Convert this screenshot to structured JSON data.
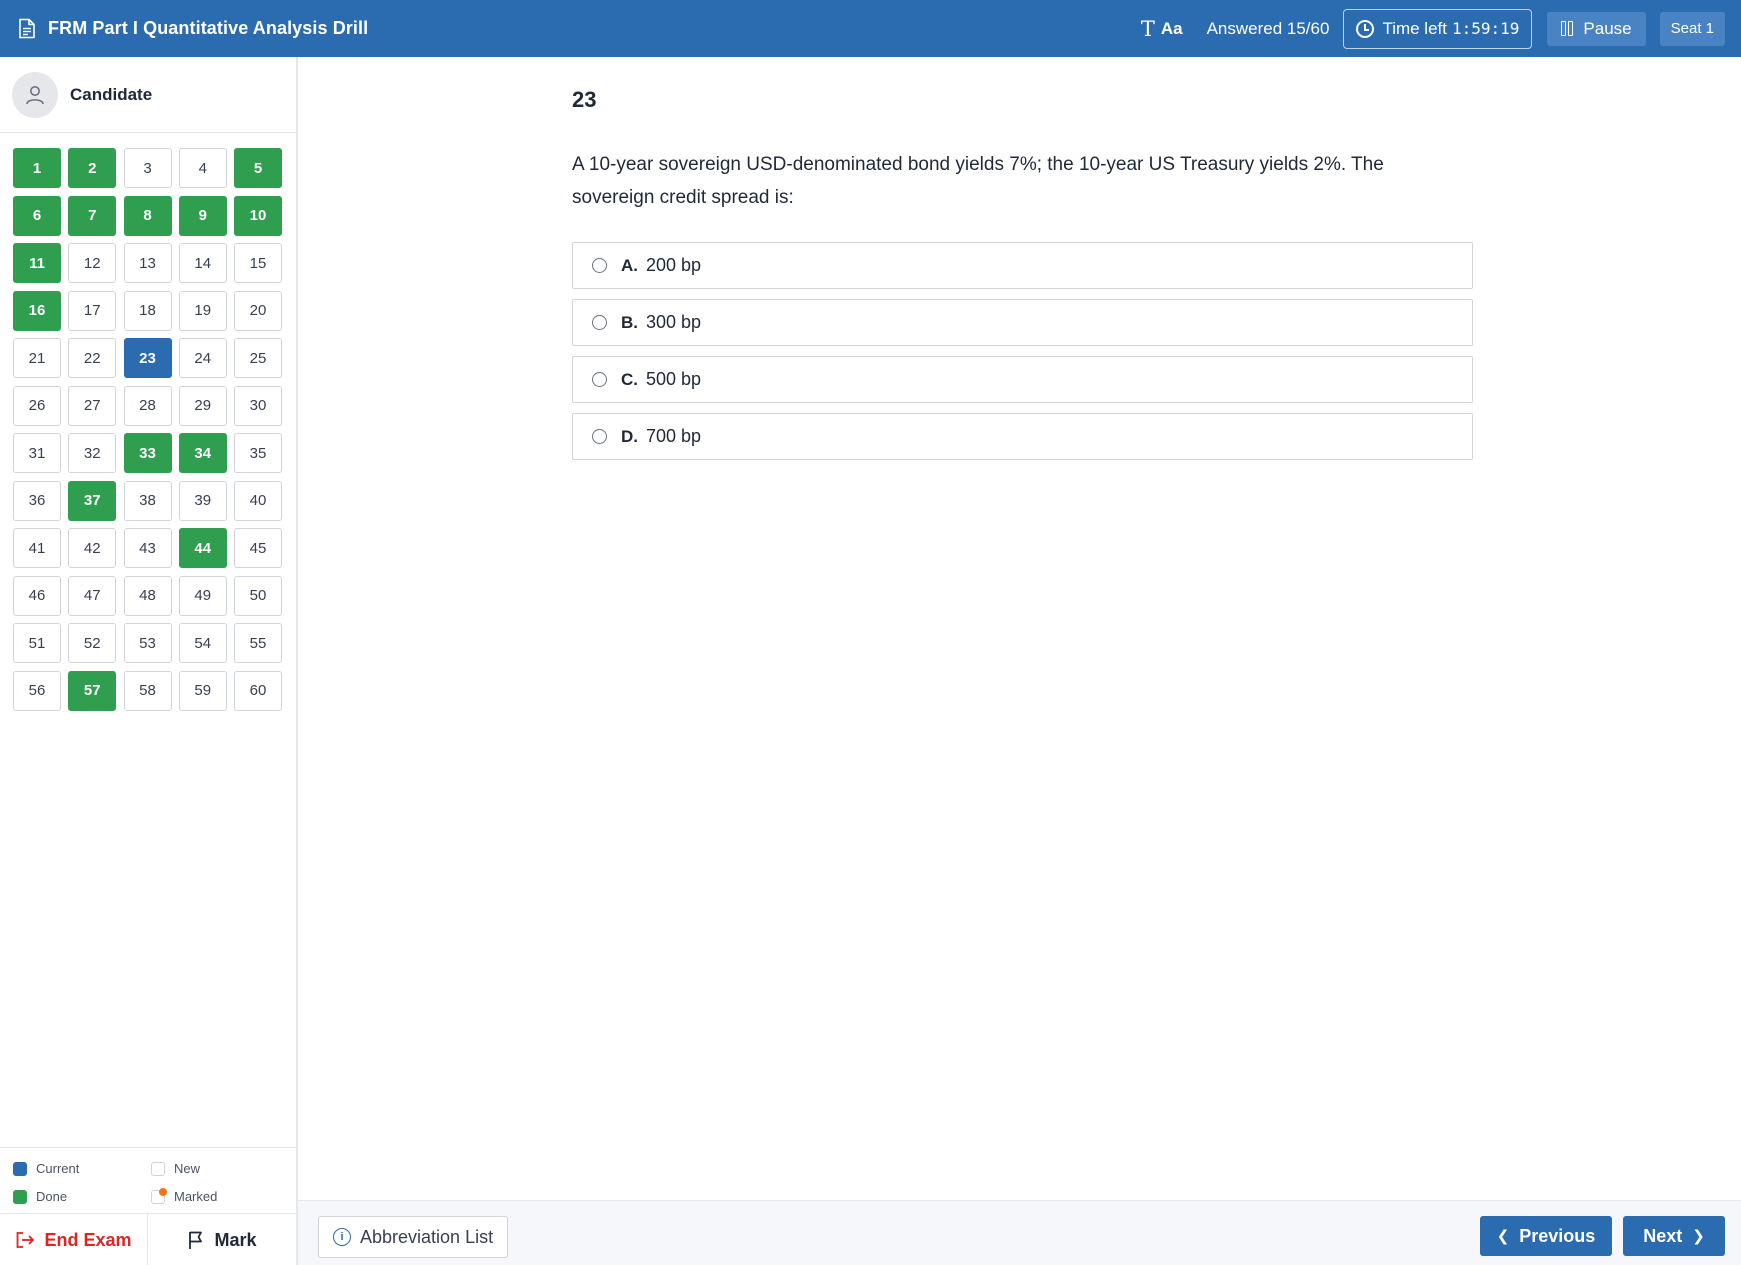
{
  "header": {
    "app_title": "FRM Part I Quantitative Analysis Drill",
    "font_size_label": "Aa",
    "answered": "Answered 15/60",
    "time_left_label": "Time left",
    "time_left_value": "1:59:19",
    "pause_label": "Pause",
    "seat_label": "Seat 1"
  },
  "sidebar": {
    "candidate_name": "Candidate",
    "questions": [
      {
        "n": "1",
        "state": "done"
      },
      {
        "n": "2",
        "state": "done"
      },
      {
        "n": "3",
        "state": "new"
      },
      {
        "n": "4",
        "state": "new"
      },
      {
        "n": "5",
        "state": "done"
      },
      {
        "n": "6",
        "state": "done"
      },
      {
        "n": "7",
        "state": "done"
      },
      {
        "n": "8",
        "state": "done"
      },
      {
        "n": "9",
        "state": "done"
      },
      {
        "n": "10",
        "state": "done"
      },
      {
        "n": "11",
        "state": "done"
      },
      {
        "n": "12",
        "state": "new"
      },
      {
        "n": "13",
        "state": "new"
      },
      {
        "n": "14",
        "state": "new"
      },
      {
        "n": "15",
        "state": "new"
      },
      {
        "n": "16",
        "state": "done"
      },
      {
        "n": "17",
        "state": "new"
      },
      {
        "n": "18",
        "state": "new"
      },
      {
        "n": "19",
        "state": "new"
      },
      {
        "n": "20",
        "state": "new"
      },
      {
        "n": "21",
        "state": "new"
      },
      {
        "n": "22",
        "state": "new"
      },
      {
        "n": "23",
        "state": "current"
      },
      {
        "n": "24",
        "state": "new"
      },
      {
        "n": "25",
        "state": "new"
      },
      {
        "n": "26",
        "state": "new"
      },
      {
        "n": "27",
        "state": "new"
      },
      {
        "n": "28",
        "state": "new"
      },
      {
        "n": "29",
        "state": "new"
      },
      {
        "n": "30",
        "state": "new"
      },
      {
        "n": "31",
        "state": "new"
      },
      {
        "n": "32",
        "state": "new"
      },
      {
        "n": "33",
        "state": "done"
      },
      {
        "n": "34",
        "state": "done"
      },
      {
        "n": "35",
        "state": "new"
      },
      {
        "n": "36",
        "state": "new"
      },
      {
        "n": "37",
        "state": "done"
      },
      {
        "n": "38",
        "state": "new"
      },
      {
        "n": "39",
        "state": "new"
      },
      {
        "n": "40",
        "state": "new"
      },
      {
        "n": "41",
        "state": "new"
      },
      {
        "n": "42",
        "state": "new"
      },
      {
        "n": "43",
        "state": "new"
      },
      {
        "n": "44",
        "state": "done"
      },
      {
        "n": "45",
        "state": "new"
      },
      {
        "n": "46",
        "state": "new"
      },
      {
        "n": "47",
        "state": "new"
      },
      {
        "n": "48",
        "state": "new"
      },
      {
        "n": "49",
        "state": "new"
      },
      {
        "n": "50",
        "state": "new"
      },
      {
        "n": "51",
        "state": "new"
      },
      {
        "n": "52",
        "state": "new"
      },
      {
        "n": "53",
        "state": "new"
      },
      {
        "n": "54",
        "state": "new"
      },
      {
        "n": "55",
        "state": "new"
      },
      {
        "n": "56",
        "state": "new"
      },
      {
        "n": "57",
        "state": "done"
      },
      {
        "n": "58",
        "state": "new"
      },
      {
        "n": "59",
        "state": "new"
      },
      {
        "n": "60",
        "state": "new"
      }
    ],
    "legend": {
      "current": "Current",
      "new": "New",
      "done": "Done",
      "marked": "Marked"
    },
    "end_exam_label": "End Exam",
    "mark_label": "Mark"
  },
  "question": {
    "number": "23",
    "text": "A 10-year sovereign USD-denominated bond yields 7%; the 10-year US Treasury yields 2%. The sovereign credit spread is:",
    "options": [
      {
        "letter": "A.",
        "text": "200 bp"
      },
      {
        "letter": "B.",
        "text": "300 bp"
      },
      {
        "letter": "C.",
        "text": "500 bp"
      },
      {
        "letter": "D.",
        "text": "700 bp"
      }
    ]
  },
  "footer": {
    "abbreviation_label": "Abbreviation List",
    "info_glyph": "i",
    "previous_label": "Previous",
    "next_label": "Next"
  },
  "colors": {
    "primary": "#2b6cb0",
    "done": "#2f9e4f",
    "marked": "#f97316",
    "danger": "#dc2626"
  }
}
